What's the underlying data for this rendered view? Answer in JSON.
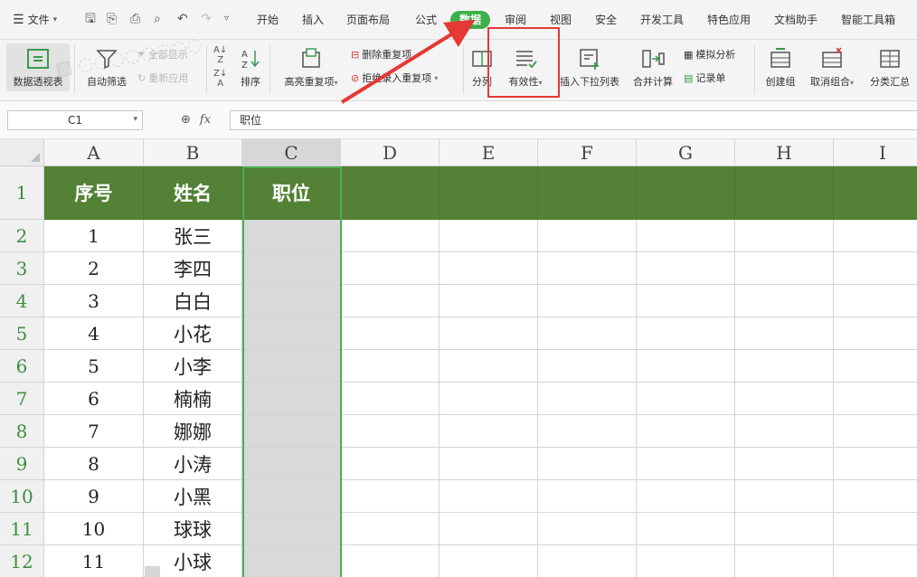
{
  "menu": {
    "file_label": "文件",
    "tabs": [
      {
        "label": "开始"
      },
      {
        "label": "插入"
      },
      {
        "label": "页面布局"
      },
      {
        "label": "公式"
      },
      {
        "label": "数据",
        "active": true
      },
      {
        "label": "审阅"
      },
      {
        "label": "视图"
      },
      {
        "label": "安全"
      },
      {
        "label": "开发工具"
      },
      {
        "label": "特色应用"
      },
      {
        "label": "文档助手"
      },
      {
        "label": "智能工具箱"
      }
    ],
    "active_color": "#3cb04a"
  },
  "ribbon": {
    "pivot": "数据透视表",
    "autofilter": "自动筛选",
    "show_all": "全部显示",
    "reapply": "重新应用",
    "sort": "排序",
    "highlight_dup": "高亮重复项",
    "remove_dup": "删除重复项",
    "reject_dup": "拒绝录入重复项",
    "split": "分列",
    "validity": "有效性",
    "insert_dropdown": "插入下拉列表",
    "consolidate": "合并计算",
    "whatif": "模拟分析",
    "record_sheet": "记录单",
    "group": "创建组",
    "ungroup": "取消组合",
    "subtotal": "分类汇总"
  },
  "formula_bar": {
    "cell_ref": "C1",
    "fx": "fx",
    "value": "职位"
  },
  "sheet": {
    "columns": [
      "A",
      "B",
      "C",
      "D",
      "E",
      "F",
      "G",
      "H",
      "I"
    ],
    "selected_column": "C",
    "header_fill": "#538135",
    "headers": [
      "序号",
      "姓名",
      "职位"
    ],
    "rows": [
      {
        "row": "1"
      },
      {
        "row": "2",
        "num": "1",
        "name": "张三"
      },
      {
        "row": "3",
        "num": "2",
        "name": "李四"
      },
      {
        "row": "4",
        "num": "3",
        "name": "白白"
      },
      {
        "row": "5",
        "num": "4",
        "name": "小花"
      },
      {
        "row": "6",
        "num": "5",
        "name": "小李"
      },
      {
        "row": "7",
        "num": "6",
        "name": "楠楠"
      },
      {
        "row": "8",
        "num": "7",
        "name": "娜娜"
      },
      {
        "row": "9",
        "num": "8",
        "name": "小涛"
      },
      {
        "row": "10",
        "num": "9",
        "name": "小黑"
      },
      {
        "row": "11",
        "num": "10",
        "name": "球球"
      },
      {
        "row": "12",
        "num": "11",
        "name": "小球"
      }
    ]
  },
  "annotation": {
    "color": "#e53935"
  }
}
